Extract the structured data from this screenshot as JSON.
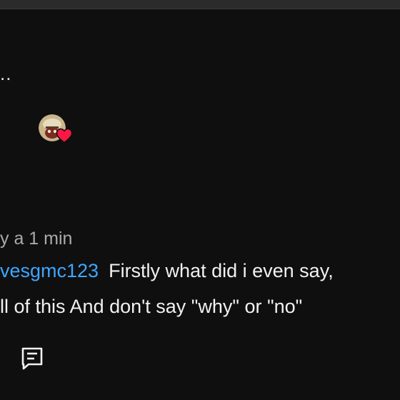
{
  "comment": {
    "ellipsis": "..",
    "timestamp": "y a 1 min",
    "mention": "vesgmc123",
    "line1_text": "Firstly what did i even say,",
    "line2_text": "ll of this And don't say \"why\" or \"no\""
  },
  "colors": {
    "background": "#0f0f0f",
    "text": "#f1f1f1",
    "mention": "#3ea6ff",
    "muted": "#aaaaaa",
    "heart": "#ff1744"
  },
  "icons": {
    "creator_heart": "heart-icon",
    "reply": "comment-reply-icon"
  }
}
